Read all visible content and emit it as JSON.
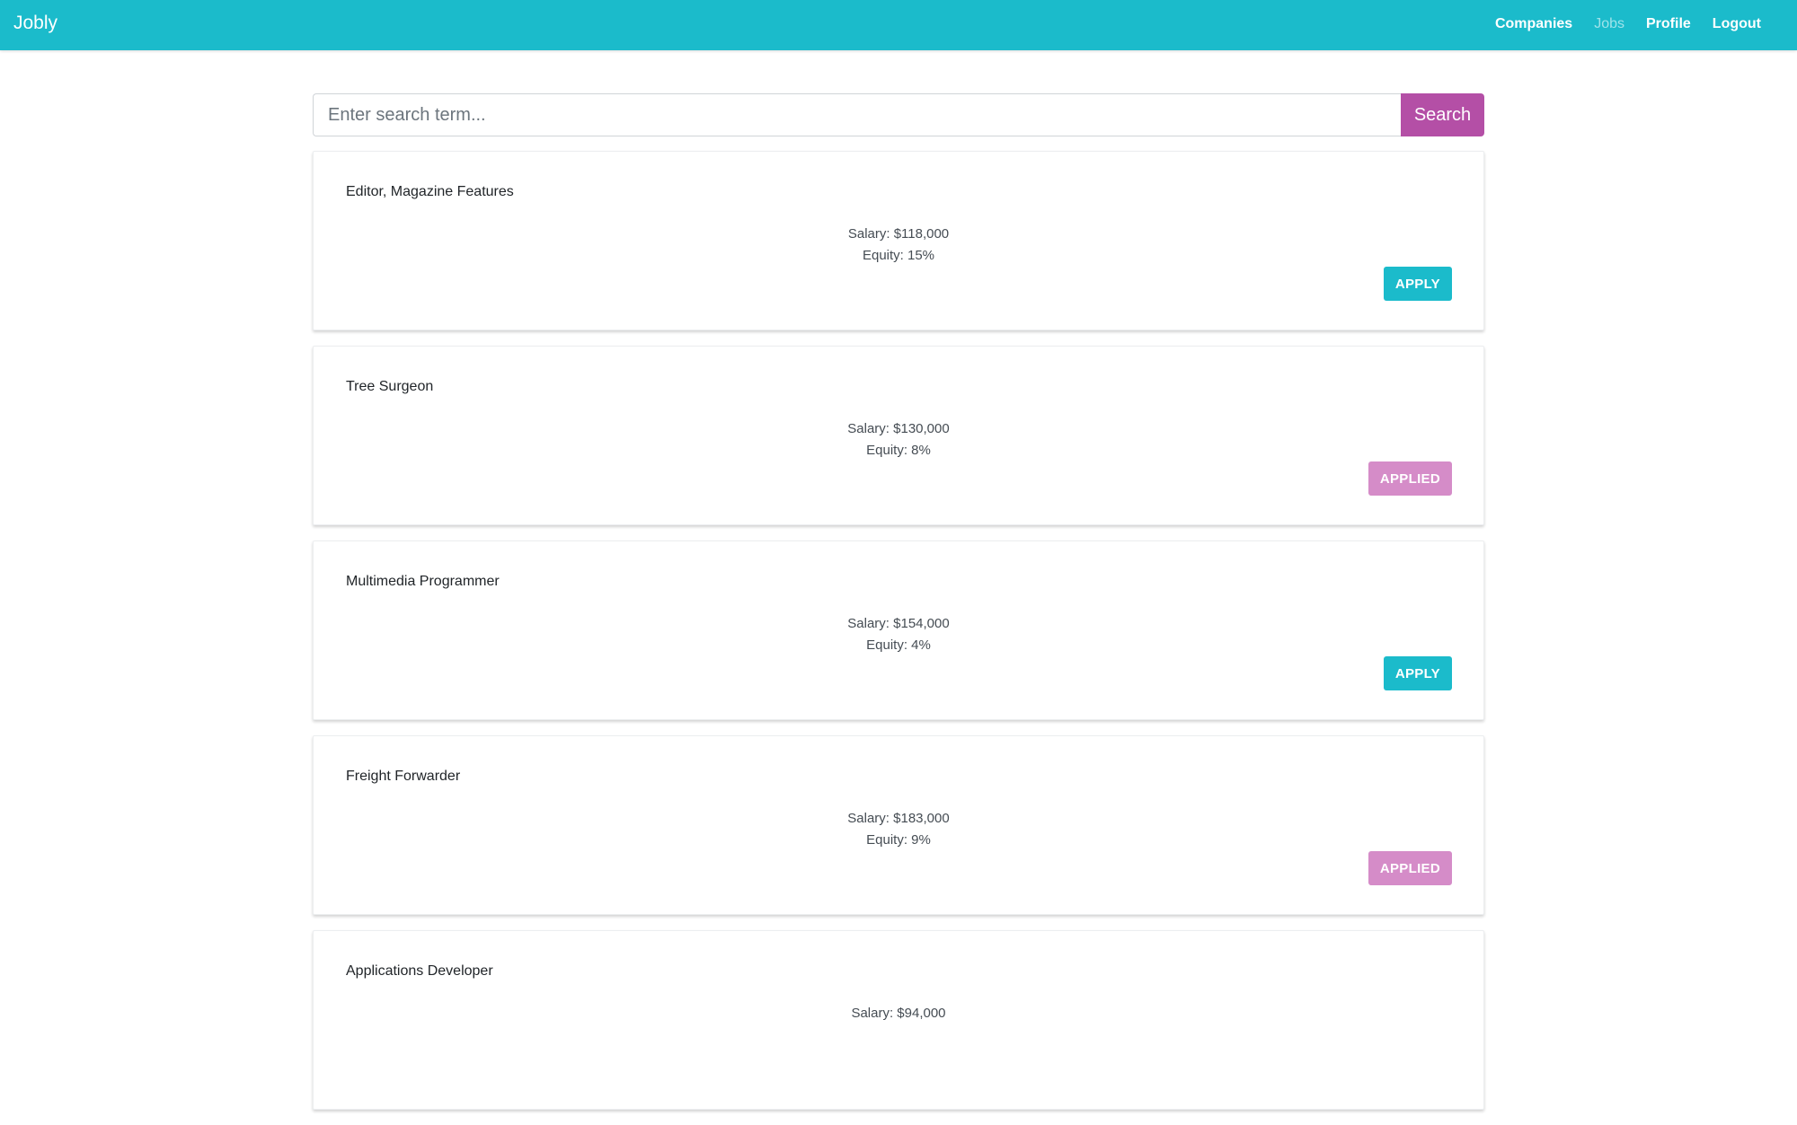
{
  "navbar": {
    "brand": "Jobly",
    "links": [
      {
        "label": "Companies",
        "active": false
      },
      {
        "label": "Jobs",
        "active": true
      },
      {
        "label": "Profile",
        "active": false
      },
      {
        "label": "Logout",
        "active": false
      }
    ]
  },
  "search": {
    "placeholder": "Enter search term...",
    "value": "",
    "button_label": "Search"
  },
  "jobs": [
    {
      "title": "Editor, Magazine Features",
      "salary": "Salary: $118,000",
      "equity": "Equity: 15%",
      "button": "APPLY",
      "applied": false
    },
    {
      "title": "Tree Surgeon",
      "salary": "Salary: $130,000",
      "equity": "Equity: 8%",
      "button": "APPLIED",
      "applied": true
    },
    {
      "title": "Multimedia Programmer",
      "salary": "Salary: $154,000",
      "equity": "Equity: 4%",
      "button": "APPLY",
      "applied": false
    },
    {
      "title": "Freight Forwarder",
      "salary": "Salary: $183,000",
      "equity": "Equity: 9%",
      "button": "APPLIED",
      "applied": true
    },
    {
      "title": "Applications Developer",
      "salary": "Salary: $94,000",
      "equity": "",
      "button": "",
      "applied": false
    }
  ],
  "colors": {
    "navbar": "#1bbbcb",
    "search_button": "#b44fa6",
    "apply_button": "#1bbbcb",
    "applied_button": "#d58cc8"
  }
}
